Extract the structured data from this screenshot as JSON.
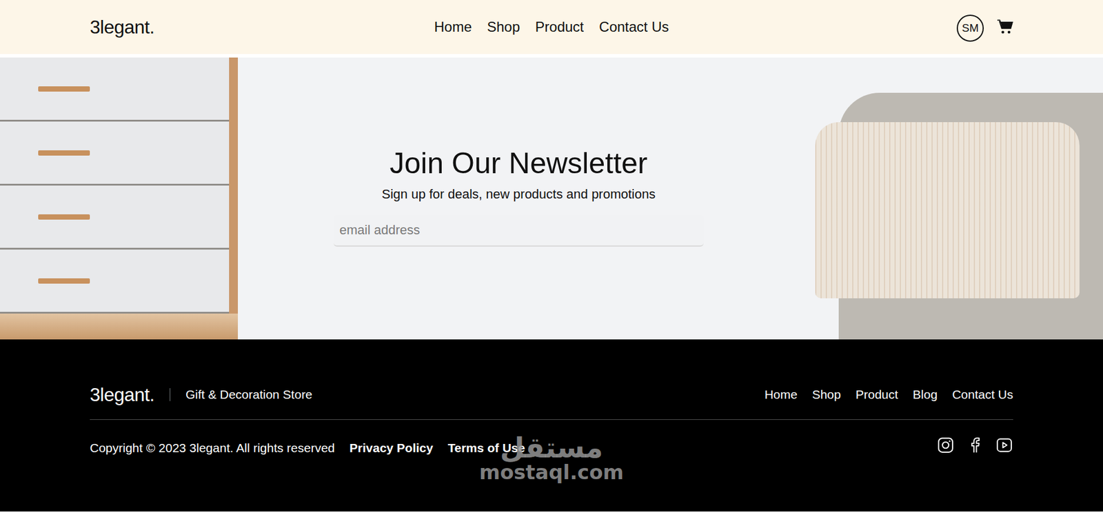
{
  "header": {
    "logo": "3legant.",
    "nav": [
      "Home",
      "Shop",
      "Product",
      "Contact Us"
    ],
    "avatar": "SM"
  },
  "newsletter": {
    "title": "Join Our Newsletter",
    "subtitle": "Sign up for deals, new products and promotions",
    "placeholder": "email address"
  },
  "footer": {
    "logo": "3legant.",
    "tagline": "Gift & Decoration Store",
    "links": [
      "Home",
      "Shop",
      "Product",
      "Blog",
      "Contact Us"
    ],
    "copyright": "Copyright © 2023 3legant. All rights reserved",
    "legal": [
      "Privacy Policy",
      "Terms of Use"
    ]
  },
  "watermark": {
    "arabic": "مستقل",
    "latin": "mostaql.com"
  }
}
